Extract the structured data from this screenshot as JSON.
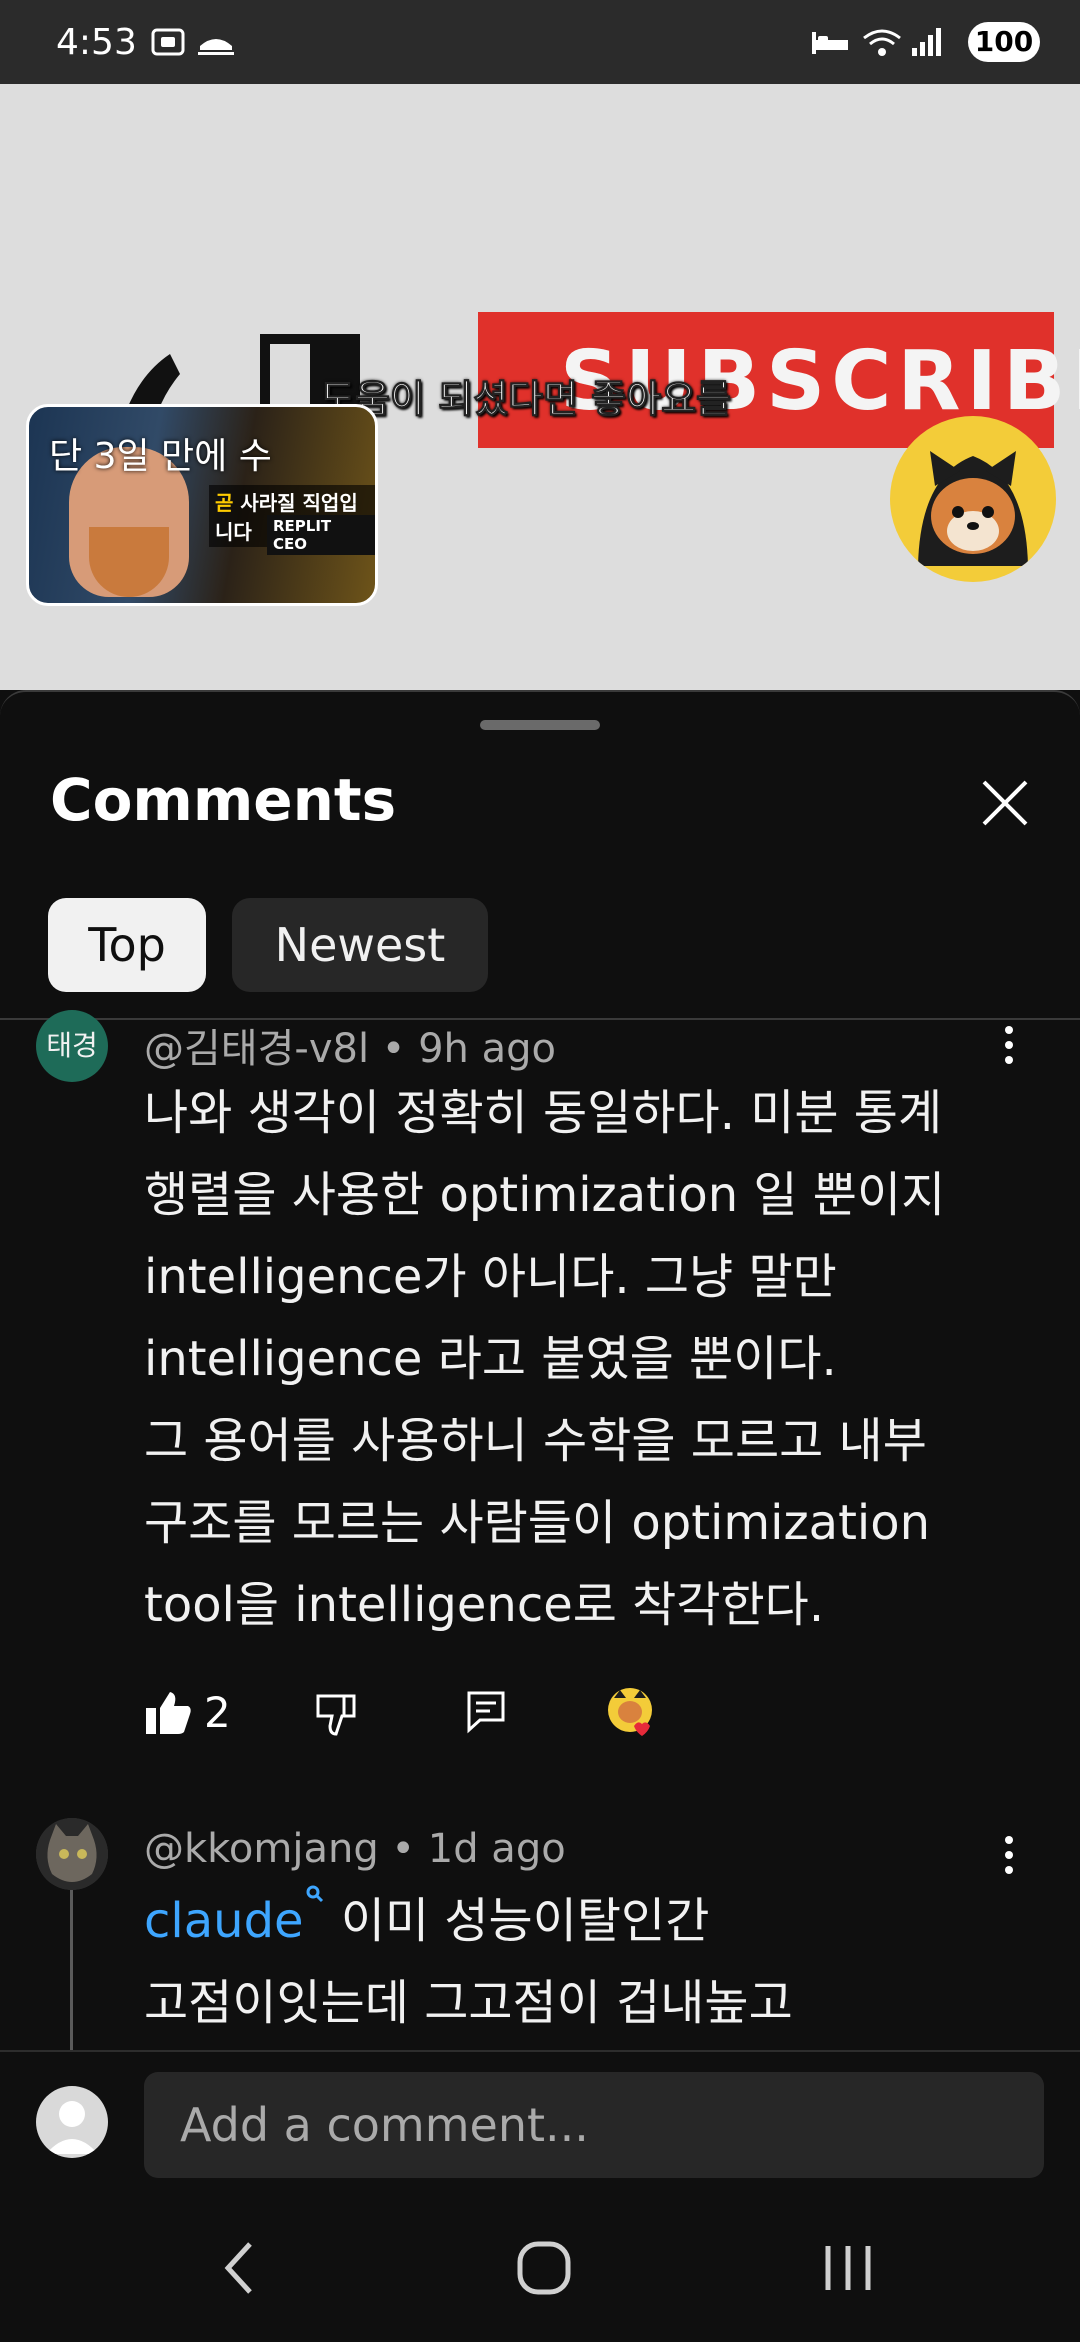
{
  "status_bar": {
    "time": "4:53",
    "battery": "100",
    "icons": [
      "screenshot-icon",
      "cast-icon",
      "sleep-icon",
      "wifi-icon",
      "signal-icon"
    ]
  },
  "video": {
    "caption": "도움이 되셨다면 좋아요를",
    "subscribe_text": "SUBSCRIBE",
    "pip": {
      "title": "단 3일 만에 수",
      "line2_highlight": "곧",
      "line2_rest": " 사라질 직업입니다",
      "tag": "REPLIT CEO"
    }
  },
  "comments_sheet": {
    "title": "Comments",
    "tabs": [
      {
        "label": "Top",
        "selected": true
      },
      {
        "label": "Newest",
        "selected": false
      }
    ],
    "comments": [
      {
        "avatar_text": "태경",
        "avatar_color": "#1e6b58",
        "author": "@김태경-v8l",
        "separator": " • ",
        "time": "9h ago",
        "lines": [
          "나와 생각이 정확히 동일하다. 미분 통계",
          "행렬을 사용한 optimization 일 뿐이지",
          "intelligence가 아니다. 그냥 말만",
          "intelligence 라고 붙였을 뿐이다.",
          "그 용어를 사용하니 수학을 모르고 내부",
          "구조를 모르는 사람들이 optimization",
          "tool을 intelligence로 착각한다."
        ],
        "likes": "2"
      },
      {
        "author": "@kkomjang",
        "separator": " • ",
        "time": "1d ago",
        "mention": "claude",
        "line1_rest": " 이미 성능이탈인간",
        "line2": "고점이잇는데 그고점이 겁내높고"
      }
    ],
    "input_placeholder": "Add a comment..."
  },
  "colors": {
    "background": "#0f0f0f",
    "link": "#3ea6ff",
    "heart": "#e62a3a",
    "subscribe_red": "#e0312b"
  }
}
